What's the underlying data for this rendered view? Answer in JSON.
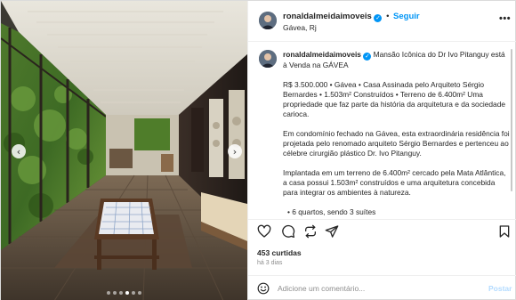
{
  "media": {
    "photo": "modernist house veranda with glass walls, forest view, stone floor, wooden bench",
    "dots_count": 6,
    "active_dot": 3,
    "prev_label": "‹",
    "next_label": "›"
  },
  "header": {
    "username": "ronaldalmeidaimoveis",
    "verified_mark": "✓",
    "separator": "•",
    "follow_label": "Seguir",
    "location": "Gávea, Rj",
    "more_label": "•••"
  },
  "caption": {
    "username": "ronaldalmeidaimoveis",
    "verified_mark": "✓",
    "title": "Mansão Icônica do Dr Ivo Pitanguy está à Venda na GÁVEA",
    "p1": "R$ 3.500.000 • Gávea • Casa Assinada pelo Arquiteto Sérgio Bernardes • 1.503m² Construídos • Terreno de 6.400m² Uma propriedade que faz parte da história da arquitetura e da sociedade carioca.",
    "p2": "Em condomínio fechado na Gávea, esta extraordinária residência foi projetada pelo renomado arquiteto Sérgio Bernardes e pertenceu ao célebre cirurgião plástico Dr. Ivo Pitanguy.",
    "p3": "Implantada em um terreno de 6.400m² cercado pela Mata Atlântica, a casa possui 1.503m² construídos e uma arquitetura concebida para integrar os ambientes à natureza.",
    "bullet": "• 6 quartos, sendo 3 suítes"
  },
  "actions": {
    "icons": [
      "heart-icon",
      "comment-icon",
      "share-icon",
      "send-icon",
      "bookmark-icon"
    ]
  },
  "stats": {
    "likes": "453 curtidas",
    "time_ago": "há 3 dias"
  },
  "comment": {
    "placeholder": "Adicione um comentário...",
    "post_label": "Postar"
  },
  "colors": {
    "accent": "#0095f6",
    "post_disabled": "#b3dbff",
    "muted": "#8e8e8e"
  }
}
